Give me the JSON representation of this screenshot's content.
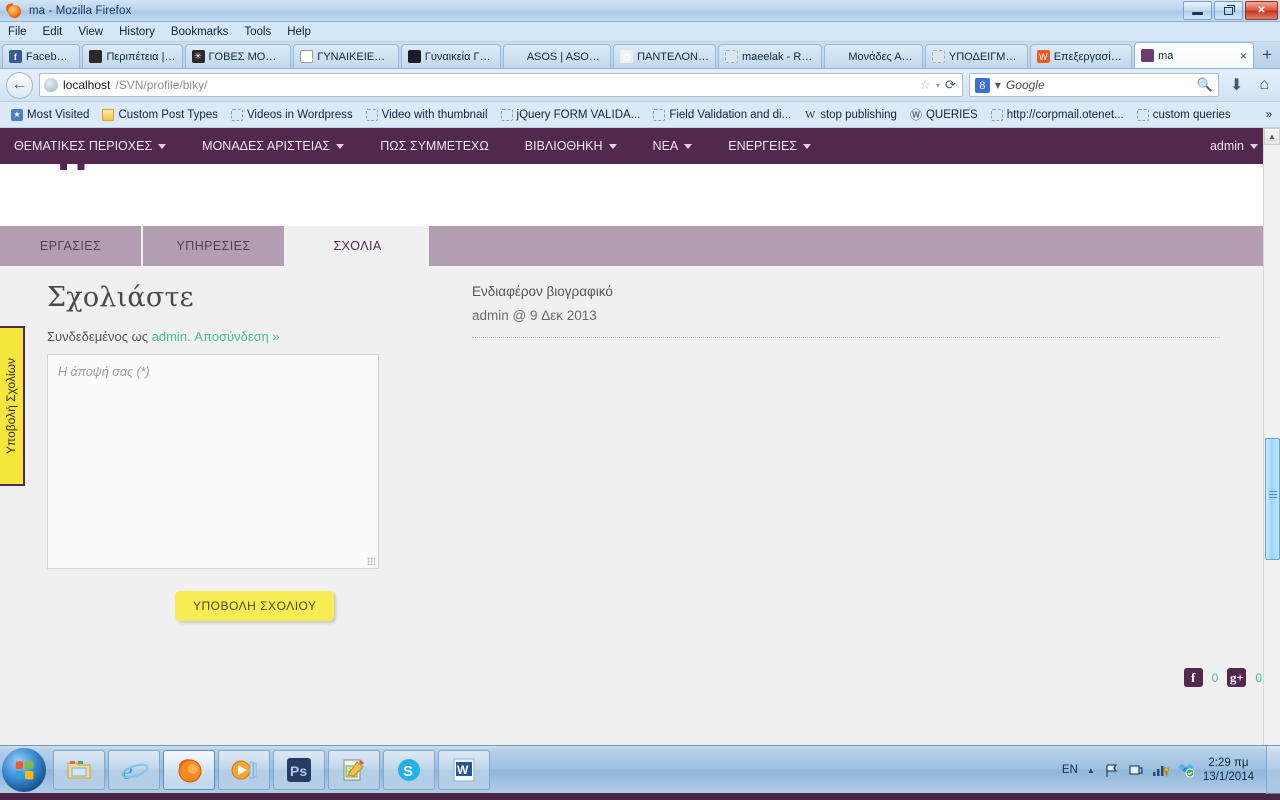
{
  "window": {
    "title": "ma - Mozilla Firefox",
    "minimize_label": "Minimize",
    "maximize_label": "Restore",
    "close_label": "Close"
  },
  "menubar": {
    "items": [
      "File",
      "Edit",
      "View",
      "History",
      "Bookmarks",
      "Tools",
      "Help"
    ]
  },
  "browser_tabs": {
    "items": [
      {
        "label": "Facebook",
        "favicon": "facebook-icon",
        "active": false
      },
      {
        "label": "Περιπέτεια | ...",
        "favicon": "site-icon",
        "active": false
      },
      {
        "label": "ΓΟΒΕΣ MOD:...",
        "favicon": "site-icon",
        "active": false
      },
      {
        "label": "ΓΥΝΑΙΚΕΙΕΣ ...",
        "favicon": "sa-icon",
        "active": false
      },
      {
        "label": "Γυναικεία Γό...",
        "favicon": "site-icon",
        "active": false
      },
      {
        "label": "ASOS | ASOS...",
        "favicon": "blank-icon",
        "active": false
      },
      {
        "label": "ΠΑΝΤΕΛΟΝΙ...",
        "favicon": "at-icon",
        "active": false
      },
      {
        "label": "maeelak - Re...",
        "favicon": "blank-icon",
        "active": false
      },
      {
        "label": "Μονάδες Αρ...",
        "favicon": "blank-icon",
        "active": false
      },
      {
        "label": "ΥΠΟΔΕΙΓΜΑ...",
        "favicon": "blank-icon",
        "active": false
      },
      {
        "label": "Επεξεργασία...",
        "favicon": "orange-icon",
        "active": false
      },
      {
        "label": "ma",
        "favicon": "ma-icon",
        "active": true
      }
    ],
    "close_tab_label": "×",
    "new_tab_label": "+"
  },
  "toolbar": {
    "back_label": "←",
    "url_host": "localhost",
    "url_path": "/SVN/profile/biky/",
    "bookmark_star": "☆",
    "dropdown_caret": "▾",
    "reload_label": "⟳",
    "search_engine": "Google",
    "search_placeholder": "Google",
    "search_value": "",
    "download_label": "⬇",
    "home_label": "⌂"
  },
  "bookmarks_bar": {
    "items": [
      {
        "label": "Most Visited",
        "icon": "star-bookmark-icon"
      },
      {
        "label": "Custom Post Types",
        "icon": "folder-icon"
      },
      {
        "label": "Videos in Wordpress",
        "icon": "blank-page-icon"
      },
      {
        "label": "Video with thumbnail",
        "icon": "blank-page-icon"
      },
      {
        "label": "jQuery FORM VALIDA...",
        "icon": "blank-page-icon"
      },
      {
        "label": "Field Validation and di...",
        "icon": "blank-page-icon"
      },
      {
        "label": "stop publishing",
        "icon": "w-icon"
      },
      {
        "label": "QUERIES",
        "icon": "wordpress-icon"
      },
      {
        "label": "http://corpmail.otenet...",
        "icon": "blank-page-icon"
      },
      {
        "label": "custom queries",
        "icon": "blank-page-icon"
      }
    ],
    "overflow_label": "»"
  },
  "site_nav": {
    "items": [
      {
        "label": "ΘΕΜΑΤΙΚΕΣ ΠΕΡΙΟΧΕΣ",
        "has_caret": true
      },
      {
        "label": "ΜΟΝΑΔΕΣ ΑΡΙΣΤΕΙΑΣ",
        "has_caret": true
      },
      {
        "label": "ΠΩΣ ΣΥΜΜΕΤΕΧΩ",
        "has_caret": false
      },
      {
        "label": "ΒΙΒΛΙΟΘΗΚΗ",
        "has_caret": true
      },
      {
        "label": "ΝΕΑ",
        "has_caret": true
      },
      {
        "label": "ΕΝΕΡΓΕΙΕΣ",
        "has_caret": true
      }
    ],
    "user": "admin",
    "brand_color": "#53284f"
  },
  "profile_tabs": {
    "items": [
      {
        "label": "ΕΡΓΑΣΙΕΣ",
        "active": false
      },
      {
        "label": "ΥΠΗΡΕΣΙΕΣ",
        "active": false
      },
      {
        "label": "ΣΧΟΛΙΑ",
        "active": true
      }
    ]
  },
  "feedback_tab": {
    "label": "Υποβολή Σχολίων",
    "background": "#f5e63c",
    "border": "#53284f"
  },
  "comment_form": {
    "heading": "Σχολιάστε",
    "logged_in_prefix": "Συνδεδεμένος ως ",
    "logged_in_link": "admin. Αποσύνδεση »",
    "textarea_placeholder": "Η άποψή σας (*)",
    "textarea_value": "",
    "submit_label": "ΥΠΟΒΟΛΗ ΣΧΟΛΙΟΥ",
    "link_color": "#4bbf9a",
    "submit_color": "#f7ec54"
  },
  "comments": {
    "items": [
      {
        "text": "Ενδιαφέρον βιογραφικό",
        "meta": "admin @ 9 Δεκ 2013"
      }
    ]
  },
  "social": {
    "items": [
      {
        "name": "facebook-share",
        "glyph": "f",
        "count": "0"
      },
      {
        "name": "google-plus-share",
        "glyph": "g+",
        "count": "0"
      }
    ],
    "count_color": "#4bbf9a"
  },
  "scrollbar": {
    "up_arrow": "▲",
    "down_arrow": "▼"
  },
  "taskbar": {
    "start_label": "Start",
    "items": [
      {
        "name": "windows-explorer",
        "label": "Windows Explorer"
      },
      {
        "name": "internet-explorer",
        "label": "Internet Explorer"
      },
      {
        "name": "firefox",
        "label": "Mozilla Firefox",
        "active": true
      },
      {
        "name": "media-player",
        "label": "Windows Media Player"
      },
      {
        "name": "photoshop",
        "label": "Ps"
      },
      {
        "name": "notepad-editor",
        "label": "Editor"
      },
      {
        "name": "skype",
        "label": "Skype"
      },
      {
        "name": "word",
        "label": "Microsoft Word"
      }
    ],
    "tray": {
      "language": "EN",
      "show_hidden": "▲",
      "icons": [
        "action-center-flag-icon",
        "network-icon",
        "volume-icon",
        "dropbox-icon"
      ],
      "time": "2:29 πμ",
      "date": "13/1/2014"
    }
  }
}
